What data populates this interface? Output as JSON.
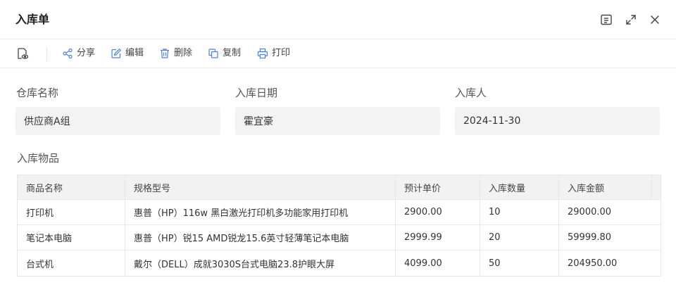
{
  "dialog": {
    "title": "入库单"
  },
  "header_icons": [
    "sidebar-panel-icon",
    "expand-icon",
    "close-icon"
  ],
  "toolbar": {
    "preview_icon": "document-preview-icon",
    "buttons": [
      {
        "label": "分享",
        "icon": "share-icon"
      },
      {
        "label": "编辑",
        "icon": "edit-icon"
      },
      {
        "label": "删除",
        "icon": "trash-icon"
      },
      {
        "label": "复制",
        "icon": "copy-icon"
      },
      {
        "label": "打印",
        "icon": "printer-icon"
      }
    ],
    "icon_color": "#4a7ee6"
  },
  "form": {
    "fields": [
      {
        "label": "仓库名称",
        "value": "供应商A组"
      },
      {
        "label": "入库日期",
        "value": "霍宜豪"
      },
      {
        "label": "入库人",
        "value": "2024-11-30"
      }
    ]
  },
  "items_section": {
    "title": "入库物品",
    "columns": [
      "商品名称",
      "规格型号",
      "预计单价",
      "入库数量",
      "入库金额"
    ],
    "rows": [
      [
        "打印机",
        "惠普（HP）116w 黑白激光打印机多功能家用打印机",
        "2900.00",
        "10",
        "29000.00"
      ],
      [
        "笔记本电脑",
        "惠普（HP）锐15 AMD锐龙15.6英寸轻薄笔记本电脑",
        "2999.99",
        "20",
        "59999.80"
      ],
      [
        "台式机",
        "戴尔（DELL）成就3030S台式电脑23.8护眼大屏",
        "4099.00",
        "50",
        "204950.00"
      ]
    ]
  }
}
